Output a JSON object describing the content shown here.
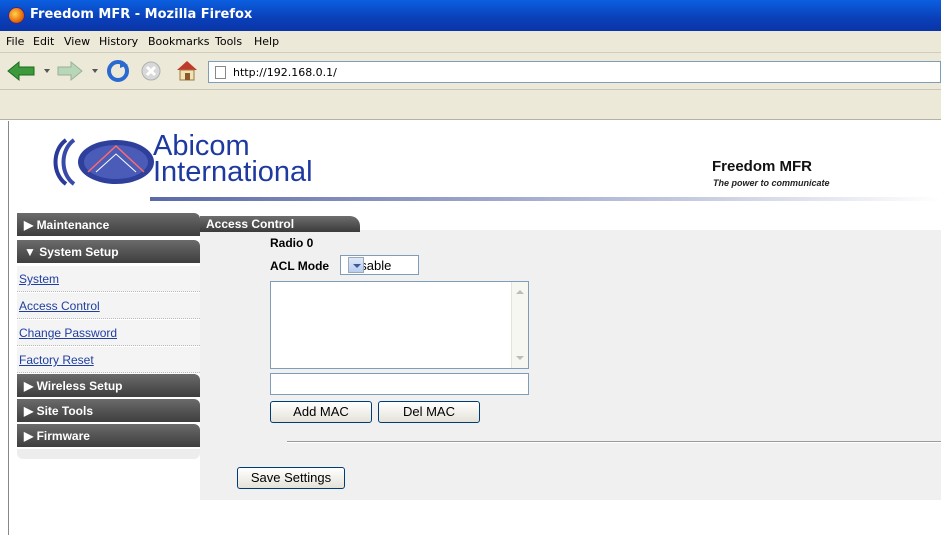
{
  "window": {
    "title": "Freedom MFR - Mozilla Firefox"
  },
  "menu": [
    "File",
    "Edit",
    "View",
    "History",
    "Bookmarks",
    "Tools",
    "Help"
  ],
  "toolbar": {
    "url": "http://192.168.0.1/",
    "icons": [
      "back-arrow-icon",
      "forward-arrow-icon",
      "reload-icon",
      "stop-icon",
      "home-icon"
    ]
  },
  "header": {
    "brand_line1": "Abicom",
    "brand_line2": "International",
    "product": "Freedom MFR",
    "tagline": "The power to communicate"
  },
  "sidebar": {
    "maintenance": "▶ Maintenance",
    "system_setup": "▼ System Setup",
    "links": [
      "System",
      "Access Control",
      "Change Password",
      "Factory Reset"
    ],
    "wireless_setup": "▶ Wireless Setup",
    "site_tools": "▶ Site Tools",
    "firmware": "▶ Firmware"
  },
  "content": {
    "tab": "Access Control",
    "radio_label": "Radio 0",
    "acl_mode_label": "ACL Mode",
    "acl_mode_value": "Disable",
    "mac_list": [],
    "mac_input_value": "",
    "add_mac": "Add MAC",
    "del_mac": "Del MAC",
    "save": "Save Settings"
  },
  "colors": {
    "titlebar": "#0a4fd0",
    "brand": "#1e3aa0",
    "sidebar_header": "#4a4a4a",
    "link": "#1f3fa0"
  }
}
